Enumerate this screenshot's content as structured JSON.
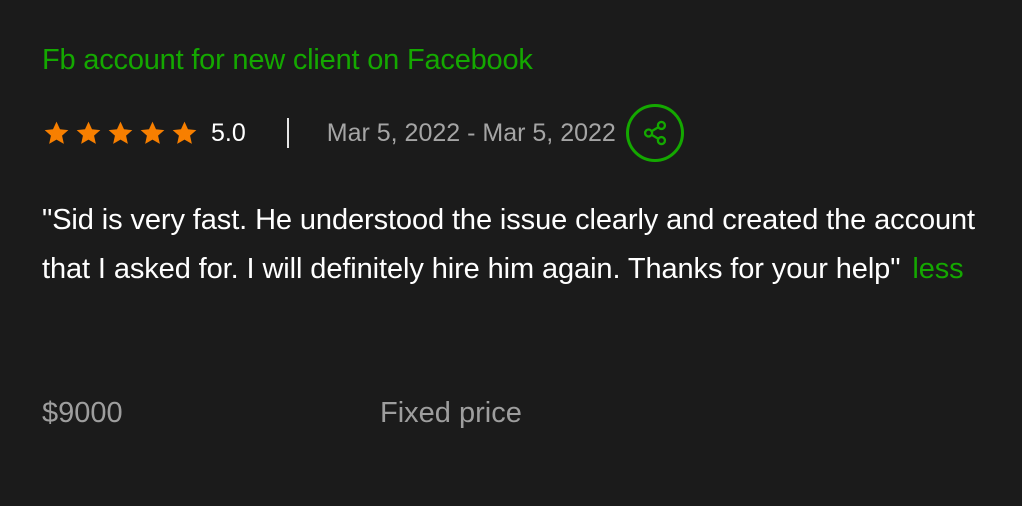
{
  "review": {
    "job_title": "Fb account for new client on Facebook",
    "rating": {
      "stars_filled": 5,
      "stars_total": 5,
      "value": "5.0",
      "star_color": "#f77f00"
    },
    "date_range": "Mar 5, 2022 - Mar 5, 2022",
    "share_icon": "share-icon",
    "feedback_text": "\"Sid is very fast. He understood the issue clearly and created the account that I asked for. I will definitely hire him again. Thanks for your help\"",
    "less_label": "less",
    "amount": "$9000",
    "price_type": "Fixed price"
  },
  "colors": {
    "background": "#1b1b1b",
    "accent": "#14a800",
    "muted_text": "#a5a5a5",
    "text": "#ffffff"
  }
}
